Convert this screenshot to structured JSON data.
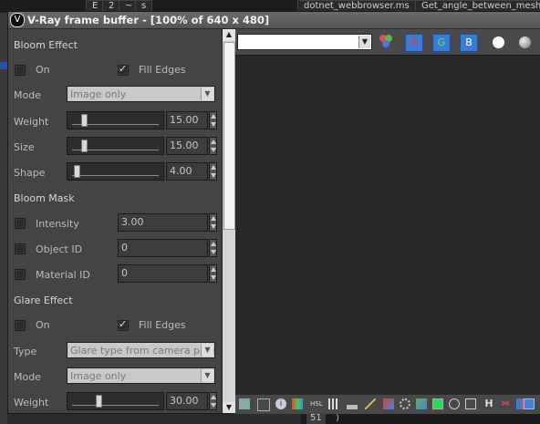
{
  "window": {
    "title": "V-Ray frame buffer - [100% of 640 x 480]"
  },
  "background": {
    "tabs": [
      "E",
      "2",
      "~",
      "s",
      "dotnet_webbrowser.ms",
      "Get_angle_between_mesh"
    ],
    "line_number": "51",
    "paren": ")"
  },
  "bloom": {
    "section": "Bloom Effect",
    "on_label": "On",
    "on_checked": false,
    "fill_edges_label": "Fill Edges",
    "fill_edges_checked": true,
    "mode_label": "Mode",
    "mode_value": "Image only",
    "weight_label": "Weight",
    "weight_value": "15.00",
    "weight_fraction": 0.15,
    "size_label": "Size",
    "size_value": "15.00",
    "size_fraction": 0.15,
    "shape_label": "Shape",
    "shape_value": "4.00",
    "shape_fraction": 0.04
  },
  "bloom_mask": {
    "section": "Bloom Mask",
    "intensity_label": "Intensity",
    "intensity_value": "3.00",
    "object_id_label": "Object ID",
    "object_id_value": "0",
    "material_id_label": "Material ID",
    "material_id_value": "0"
  },
  "glare": {
    "section": "Glare Effect",
    "on_label": "On",
    "on_checked": false,
    "fill_edges_label": "Fill Edges",
    "fill_edges_checked": true,
    "type_label": "Type",
    "type_value": "Glare type from camera param",
    "mode_label": "Mode",
    "mode_value": "Image only",
    "weight_label": "Weight",
    "weight_value": "30.00",
    "weight_fraction": 0.3
  },
  "toolbar": {
    "channel_value": "",
    "r_label": "R",
    "g_label": "G",
    "b_label": "B"
  },
  "bottom_icons": [
    "save-icon",
    "history-icon",
    "info-icon",
    "color-correct-icon",
    "hsl-icon",
    "levels-icon",
    "histogram-icon",
    "curves-icon",
    "lut-icon",
    "exposure-icon",
    "background-icon",
    "ocio-icon",
    "white-balance-icon",
    "h-icon",
    "compare-icon",
    "split-icon",
    "stamp-icon"
  ],
  "colors": {
    "rgb_button": "#3a7bd5",
    "panel_bg": "#444444",
    "viewport_bg": "#282828"
  }
}
